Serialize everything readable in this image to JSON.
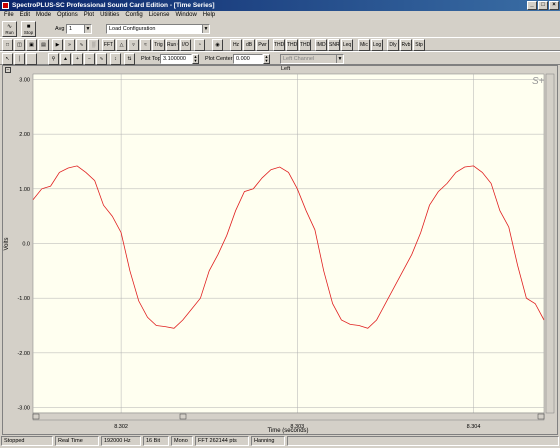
{
  "window": {
    "title": "SpectroPLUS-SC Professional Sound Card Edition - [Time Series]",
    "controls": [
      "_",
      "□",
      "×"
    ]
  },
  "menu": [
    "File",
    "Edit",
    "Mode",
    "Options",
    "Plot",
    "Utilities",
    "Config",
    "License",
    "Window",
    "Help"
  ],
  "toolbar1": {
    "run_label": "Run",
    "stop_label": "Stop",
    "avg_label": "Avg",
    "avg_value": "1",
    "config_value": "Load Configuration"
  },
  "toolbar2": {
    "buttons": [
      "FFT",
      "Trig",
      "Run Ctrl",
      "I/O",
      "Hz",
      "dB",
      "Pwr",
      "THD",
      "THD+N",
      "THD Freq",
      "IMD",
      "SNR",
      "Leq",
      "Mic",
      "Log",
      "Dly",
      "Rvb",
      "Stp"
    ]
  },
  "toolbar3": {
    "plot_top_label": "Plot Top",
    "plot_top_value": "3.100000",
    "plot_center_label": "Plot Center",
    "plot_center_value": "0.000",
    "channel_value": "Left Channel"
  },
  "plot": {
    "header": "Left",
    "logo": "S+"
  },
  "chart_data": {
    "type": "line",
    "title": "",
    "xlabel": "Time (seconds)",
    "ylabel": "Volts",
    "xlim": [
      8.3015,
      8.3044
    ],
    "ylim": [
      -3.1,
      3.1
    ],
    "xticks": [
      8.302,
      8.303,
      8.304
    ],
    "xtick_labels": [
      "8.302",
      "8.303",
      "8.304"
    ],
    "yticks": [
      3.0,
      2.0,
      1.0,
      0.0,
      -1.0,
      -2.0,
      -3.0
    ],
    "ytick_labels": [
      "3.00",
      "2.00",
      "1.00",
      "0.0",
      "-1.00",
      "-2.00",
      "-3.00"
    ],
    "grid": true,
    "line_color": "#e02020",
    "series": [
      {
        "x": [
          8.3015,
          8.30155,
          8.3016,
          8.30165,
          8.3017,
          8.30175,
          8.3018,
          8.30185,
          8.3019,
          8.30195,
          8.302,
          8.30205,
          8.3021,
          8.30215,
          8.3022,
          8.30225,
          8.3023,
          8.30235,
          8.3024,
          8.30245,
          8.3025,
          8.30255,
          8.3026,
          8.30265,
          8.3027,
          8.30275,
          8.3028,
          8.30285,
          8.3029,
          8.30295,
          8.303,
          8.30305,
          8.3031,
          8.30315,
          8.3032,
          8.30325,
          8.3033,
          8.30335,
          8.3034,
          8.30345,
          8.3035,
          8.30355,
          8.3036,
          8.30365,
          8.3037,
          8.30375,
          8.3038,
          8.30385,
          8.3039,
          8.30395,
          8.304,
          8.30405,
          8.3041,
          8.30415,
          8.3042,
          8.30425,
          8.3043,
          8.30435,
          8.3044
        ],
        "y": [
          0.8,
          1.0,
          1.05,
          1.3,
          1.38,
          1.42,
          1.3,
          1.15,
          0.7,
          0.5,
          0.2,
          -0.5,
          -1.05,
          -1.35,
          -1.5,
          -1.52,
          -1.55,
          -1.4,
          -1.2,
          -1.0,
          -0.5,
          -0.2,
          0.15,
          0.6,
          0.95,
          1.0,
          1.2,
          1.35,
          1.4,
          1.3,
          1.0,
          0.6,
          0.25,
          -0.5,
          -1.1,
          -1.4,
          -1.48,
          -1.5,
          -1.55,
          -1.4,
          -1.1,
          -0.8,
          -0.5,
          -0.2,
          0.2,
          0.7,
          0.95,
          1.1,
          1.3,
          1.4,
          1.42,
          1.3,
          1.1,
          0.6,
          0.3,
          -0.4,
          -1.0,
          -1.1,
          -1.4
        ]
      }
    ]
  },
  "status": [
    "Stopped",
    "Real Time",
    "192000 Hz",
    "16 Bit",
    "Mono",
    "FFT 262144 pts",
    "Hanning"
  ]
}
